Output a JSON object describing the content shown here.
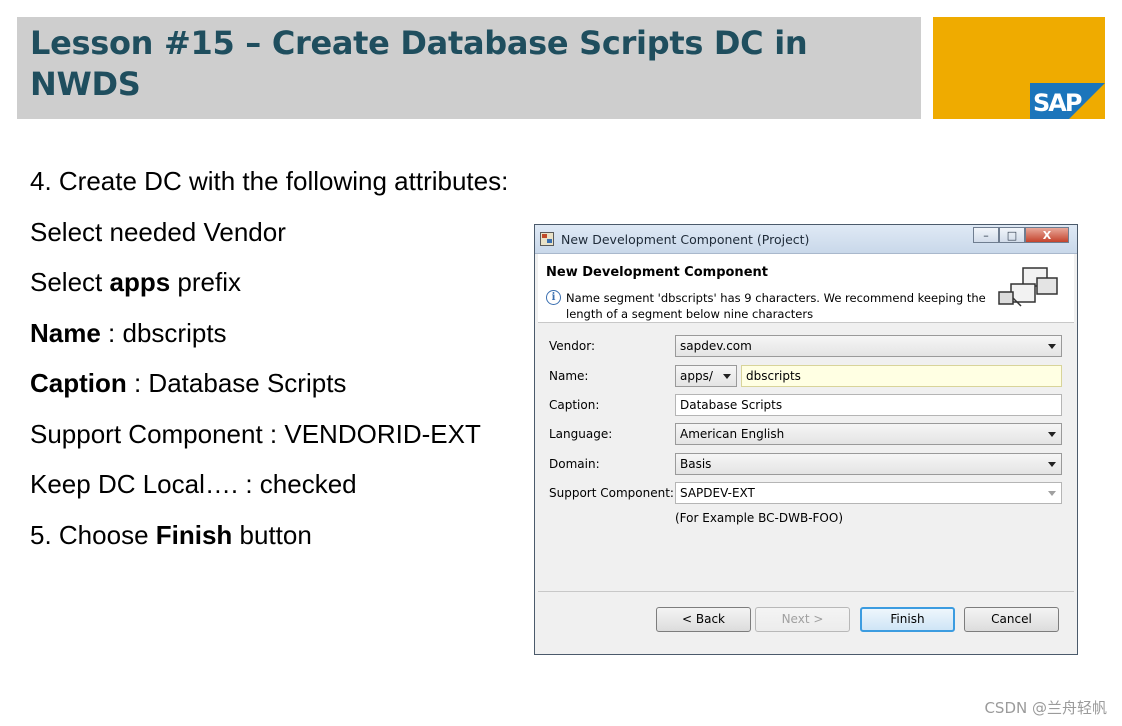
{
  "slide": {
    "title": "Lesson #15 – Create Database Scripts DC in NWDS",
    "logo_text": "SAP",
    "bullets": [
      {
        "plain": "4. Create DC with  the following attributes:"
      },
      {
        "plain": "Select needed Vendor"
      },
      {
        "pre": "Select ",
        "bold": "apps",
        "post": " prefix"
      },
      {
        "pre": "",
        "bold": "Name",
        "post": " : dbscripts"
      },
      {
        "pre": "",
        "bold": "Caption",
        "post": " : Database Scripts"
      },
      {
        "plain": "Support Component : VENDORID-EXT"
      },
      {
        "plain": "Keep DC Local…. : checked"
      },
      {
        "pre": "5. Choose ",
        "bold": "Finish",
        "post": " button"
      }
    ],
    "watermark": "CSDN @兰舟轻帆"
  },
  "dialog": {
    "window_title": "New Development Component (Project)",
    "heading": "New Development Component",
    "info_message": "Name segment 'dbscripts' has 9 characters. We recommend keeping the length of a segment below nine characters",
    "fields": {
      "vendor": {
        "label": "Vendor:",
        "value": "sapdev.com"
      },
      "name": {
        "label": "Name:",
        "prefix": "apps/",
        "value": "dbscripts"
      },
      "caption": {
        "label": "Caption:",
        "value": "Database Scripts"
      },
      "language": {
        "label": "Language:",
        "value": "American English"
      },
      "domain": {
        "label": "Domain:",
        "value": "Basis"
      },
      "support_component": {
        "label": "Support Component:",
        "value": "SAPDEV-EXT"
      }
    },
    "example_text": "(For Example BC-DWB-FOO)",
    "buttons": {
      "back": "< Back",
      "next": "Next >",
      "finish": "Finish",
      "cancel": "Cancel"
    },
    "window_buttons": {
      "minimize": "–",
      "maximize": "□",
      "close": "X"
    }
  },
  "colors": {
    "title_text": "#1f4e5e",
    "title_bar": "#cecece",
    "logo_gold": "#efab00",
    "logo_blue": "#1b75bb"
  }
}
